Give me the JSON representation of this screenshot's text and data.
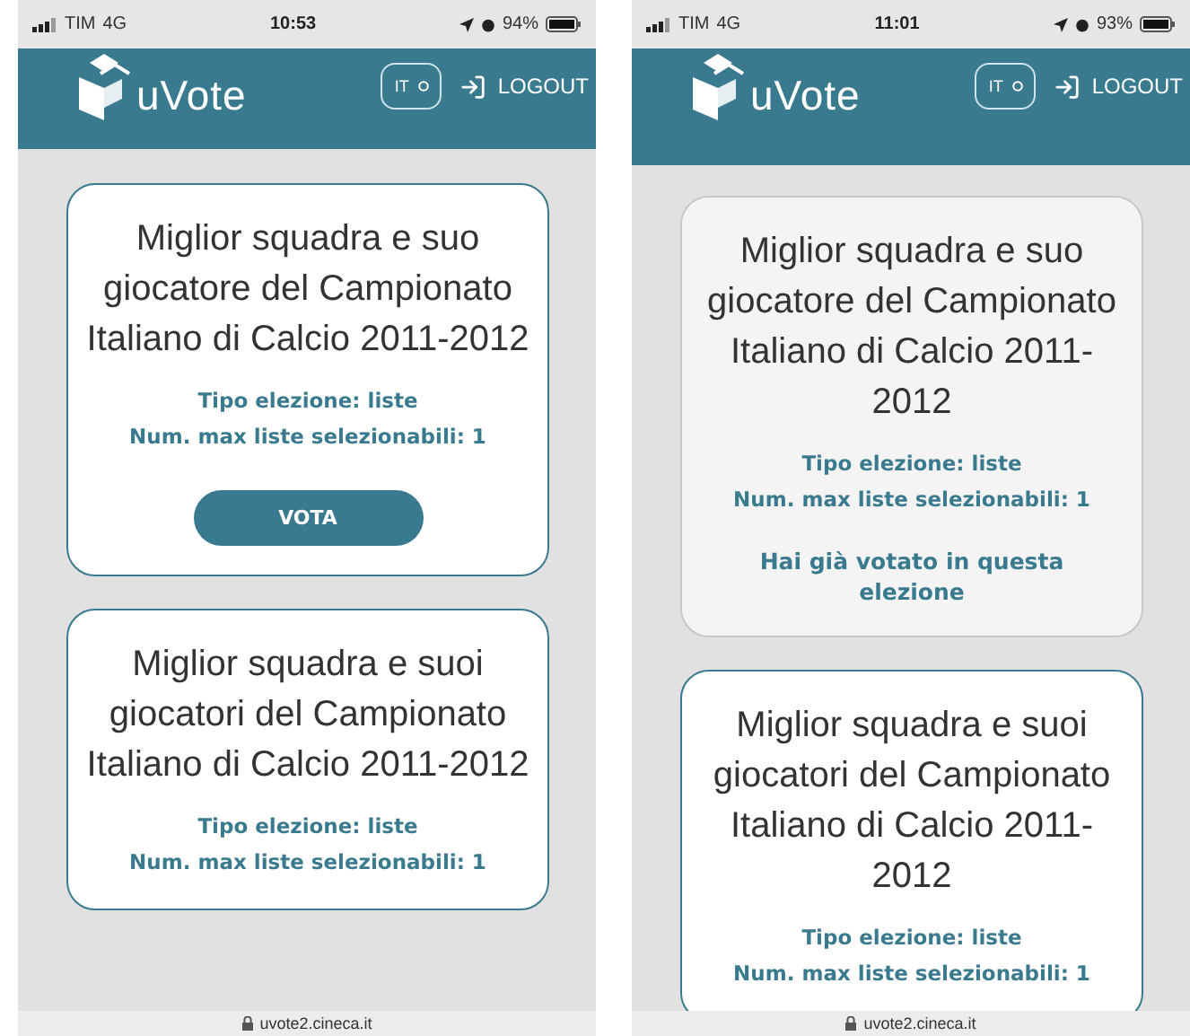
{
  "phones": [
    {
      "status": {
        "carrier": "TIM",
        "network": "4G",
        "time": "10:53",
        "battery": "94%"
      },
      "header": {
        "logo": "uVote",
        "language": "IT",
        "logout": "LOGOUT"
      },
      "cards": [
        {
          "kind": "open",
          "title": "Miglior squadra e suo giocatore del Campionato Italiano di Calcio 2011-2012",
          "type": "Tipo elezione: liste",
          "max": "Num. max liste selezionabili: 1",
          "action": "VOTA"
        },
        {
          "kind": "open",
          "title": "Miglior squadra e suoi giocatori del Campionato Italiano di Calcio 2011-2012",
          "type": "Tipo elezione: liste",
          "max": "Num. max liste selezionabili: 1"
        }
      ],
      "url": "uvote2.cineca.it"
    },
    {
      "status": {
        "carrier": "TIM",
        "network": "4G",
        "time": "11:01",
        "battery": "93%"
      },
      "header": {
        "logo": "uVote",
        "language": "IT",
        "logout": "LOGOUT"
      },
      "cards": [
        {
          "kind": "voted",
          "title": "Miglior squadra e suo giocatore del Campionato Italiano di Calcio 2011-2012",
          "type": "Tipo elezione: liste",
          "max": "Num. max liste selezionabili: 1",
          "action": "Hai già votato in questa elezione"
        },
        {
          "kind": "open",
          "title": "Miglior squadra e suoi giocatori del Campionato Italiano di Calcio 2011-2012",
          "type": "Tipo elezione: liste",
          "max": "Num. max liste selezionabili: 1"
        }
      ],
      "url": "uvote2.cineca.it"
    }
  ]
}
